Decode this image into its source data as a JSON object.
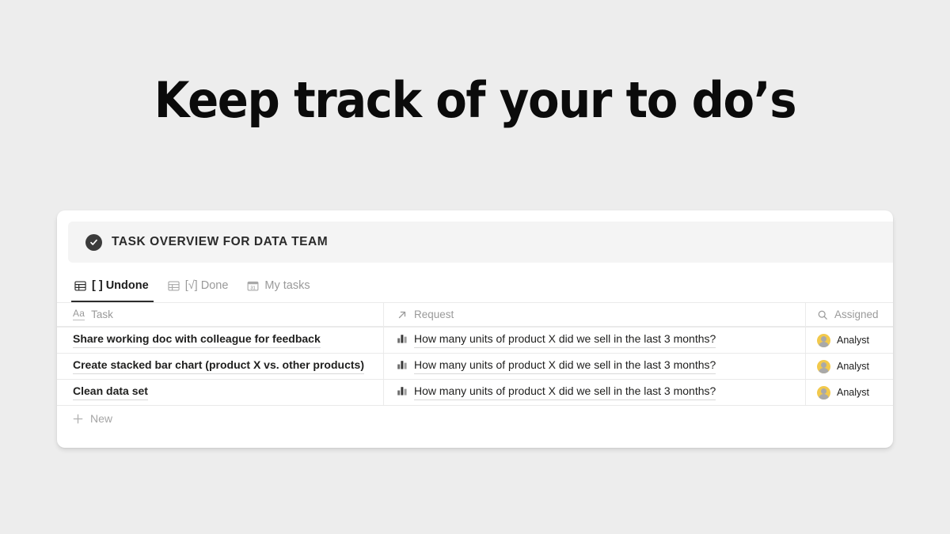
{
  "headline": "Keep track of your to do’s",
  "card": {
    "header": {
      "icon": "check-circle-icon",
      "title": "TASK OVERVIEW FOR DATA TEAM"
    },
    "tabs": [
      {
        "label": "[ ] Undone",
        "icon": "table-icon",
        "active": true
      },
      {
        "label": "[√] Done",
        "icon": "table-icon",
        "active": false
      },
      {
        "label": "My tasks",
        "icon": "calendar-icon",
        "active": false
      }
    ],
    "table": {
      "columns": [
        {
          "label": "Task",
          "icon": "text-aa-icon"
        },
        {
          "label": "Request",
          "icon": "arrow-up-right-icon"
        },
        {
          "label": "Assigned",
          "icon": "search-icon"
        }
      ],
      "rows": [
        {
          "task": "Share working doc with colleague for feedback",
          "request": "How many units of product X did we sell in the last 3 months?",
          "request_icon": "bar-chart-icon",
          "assigned": "Analyst",
          "avatar": "person-avatar"
        },
        {
          "task": "Create stacked bar chart (product X vs. other products)",
          "request": "How many units of product X did we sell in the last 3 months?",
          "request_icon": "bar-chart-icon",
          "assigned": "Analyst",
          "avatar": "person-avatar"
        },
        {
          "task": "Clean data set",
          "request": "How many units of product X did we sell in the last 3 months?",
          "request_icon": "bar-chart-icon",
          "assigned": "Analyst",
          "avatar": "person-avatar"
        }
      ],
      "new_row_label": "New",
      "new_row_icon": "plus-icon"
    }
  },
  "colors": {
    "page_background": "#ededed",
    "card_background": "#ffffff",
    "header_bar": "#f4f4f4",
    "accent_dark": "#3b3b3b",
    "avatar_yellow": "#f2c94c",
    "muted_text": "#9a9a9a"
  }
}
